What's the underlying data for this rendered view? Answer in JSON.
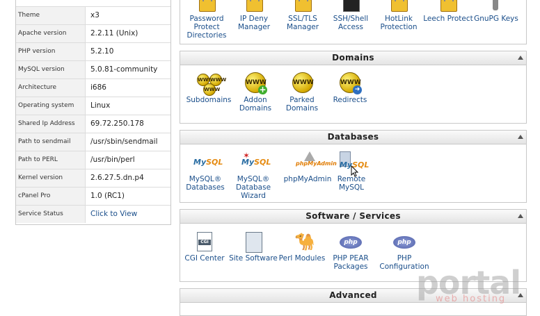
{
  "stats": [
    {
      "label": "Theme",
      "value": "x3"
    },
    {
      "label": "Apache version",
      "value": "2.2.11 (Unix)"
    },
    {
      "label": "PHP version",
      "value": "5.2.10"
    },
    {
      "label": "MySQL version",
      "value": "5.0.81-community"
    },
    {
      "label": "Architecture",
      "value": "i686"
    },
    {
      "label": "Operating system",
      "value": "Linux"
    },
    {
      "label": "Shared Ip Address",
      "value": "69.72.250.178"
    },
    {
      "label": "Path to sendmail",
      "value": "/usr/sbin/sendmail"
    },
    {
      "label": "Path to PERL",
      "value": "/usr/bin/perl"
    },
    {
      "label": "Kernel version",
      "value": "2.6.27.5.dn.p4"
    },
    {
      "label": "cPanel Pro",
      "value": "1.0 (RC1)"
    },
    {
      "label": "Service Status",
      "value": "Click to View"
    }
  ],
  "security": {
    "items": [
      {
        "label": "Password Protect Directories",
        "icon": "folder-lock-icon"
      },
      {
        "label": "IP Deny Manager",
        "icon": "ip-deny-icon"
      },
      {
        "label": "SSL/TLS Manager",
        "icon": "ssl-icon"
      },
      {
        "label": "SSH/Shell Access",
        "icon": "ssh-terminal-icon"
      },
      {
        "label": "HotLink Protection",
        "icon": "hotlink-icon"
      },
      {
        "label": "Leech Protect",
        "icon": "leech-icon"
      },
      {
        "label": "GnuPG Keys",
        "icon": "keys-icon"
      }
    ]
  },
  "domains": {
    "title": "Domains",
    "items": [
      {
        "label": "Subdomains",
        "icon": "www-subdomains-icon"
      },
      {
        "label": "Addon Domains",
        "icon": "www-addon-icon"
      },
      {
        "label": "Parked Domains",
        "icon": "www-parked-icon"
      },
      {
        "label": "Redirects",
        "icon": "www-redirect-icon"
      }
    ]
  },
  "databases": {
    "title": "Databases",
    "items": [
      {
        "label": "MySQL® Databases",
        "icon": "mysql-icon"
      },
      {
        "label": "MySQL® Database Wizard",
        "icon": "mysql-wizard-icon"
      },
      {
        "label": "phpMyAdmin",
        "icon": "phpmyadmin-icon"
      },
      {
        "label": "Remote MySQL",
        "icon": "remote-mysql-icon"
      }
    ]
  },
  "software": {
    "title": "Software / Services",
    "items": [
      {
        "label": "CGI Center",
        "icon": "cgi-icon",
        "badge": "CGI"
      },
      {
        "label": "Site Software",
        "icon": "site-software-icon"
      },
      {
        "label": "Perl Modules",
        "icon": "perl-camel-icon"
      },
      {
        "label": "PHP PEAR Packages",
        "icon": "php-pear-icon",
        "badge": "php"
      },
      {
        "label": "PHP Configuration",
        "icon": "php-config-icon",
        "badge": "php"
      }
    ]
  },
  "advanced": {
    "title": "Advanced"
  },
  "logos": {
    "www": "WWW",
    "mysql_a": "My",
    "mysql_b": "SQL",
    "pma": "phpMyAdmin"
  },
  "watermark": {
    "main": "portal",
    "sub": "web hosting"
  }
}
